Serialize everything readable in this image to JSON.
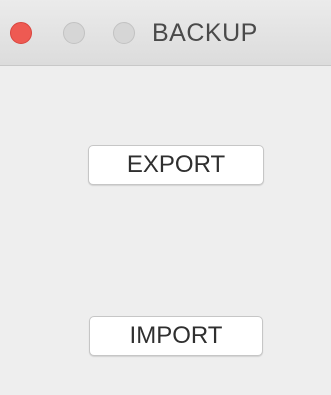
{
  "window": {
    "title": "BACKUP",
    "controls": {
      "close_color": "#ee5a52",
      "minimize_color": "#d6d6d6",
      "zoom_color": "#d6d6d6"
    }
  },
  "actions": {
    "export_label": "EXPORT",
    "import_label": "IMPORT"
  }
}
